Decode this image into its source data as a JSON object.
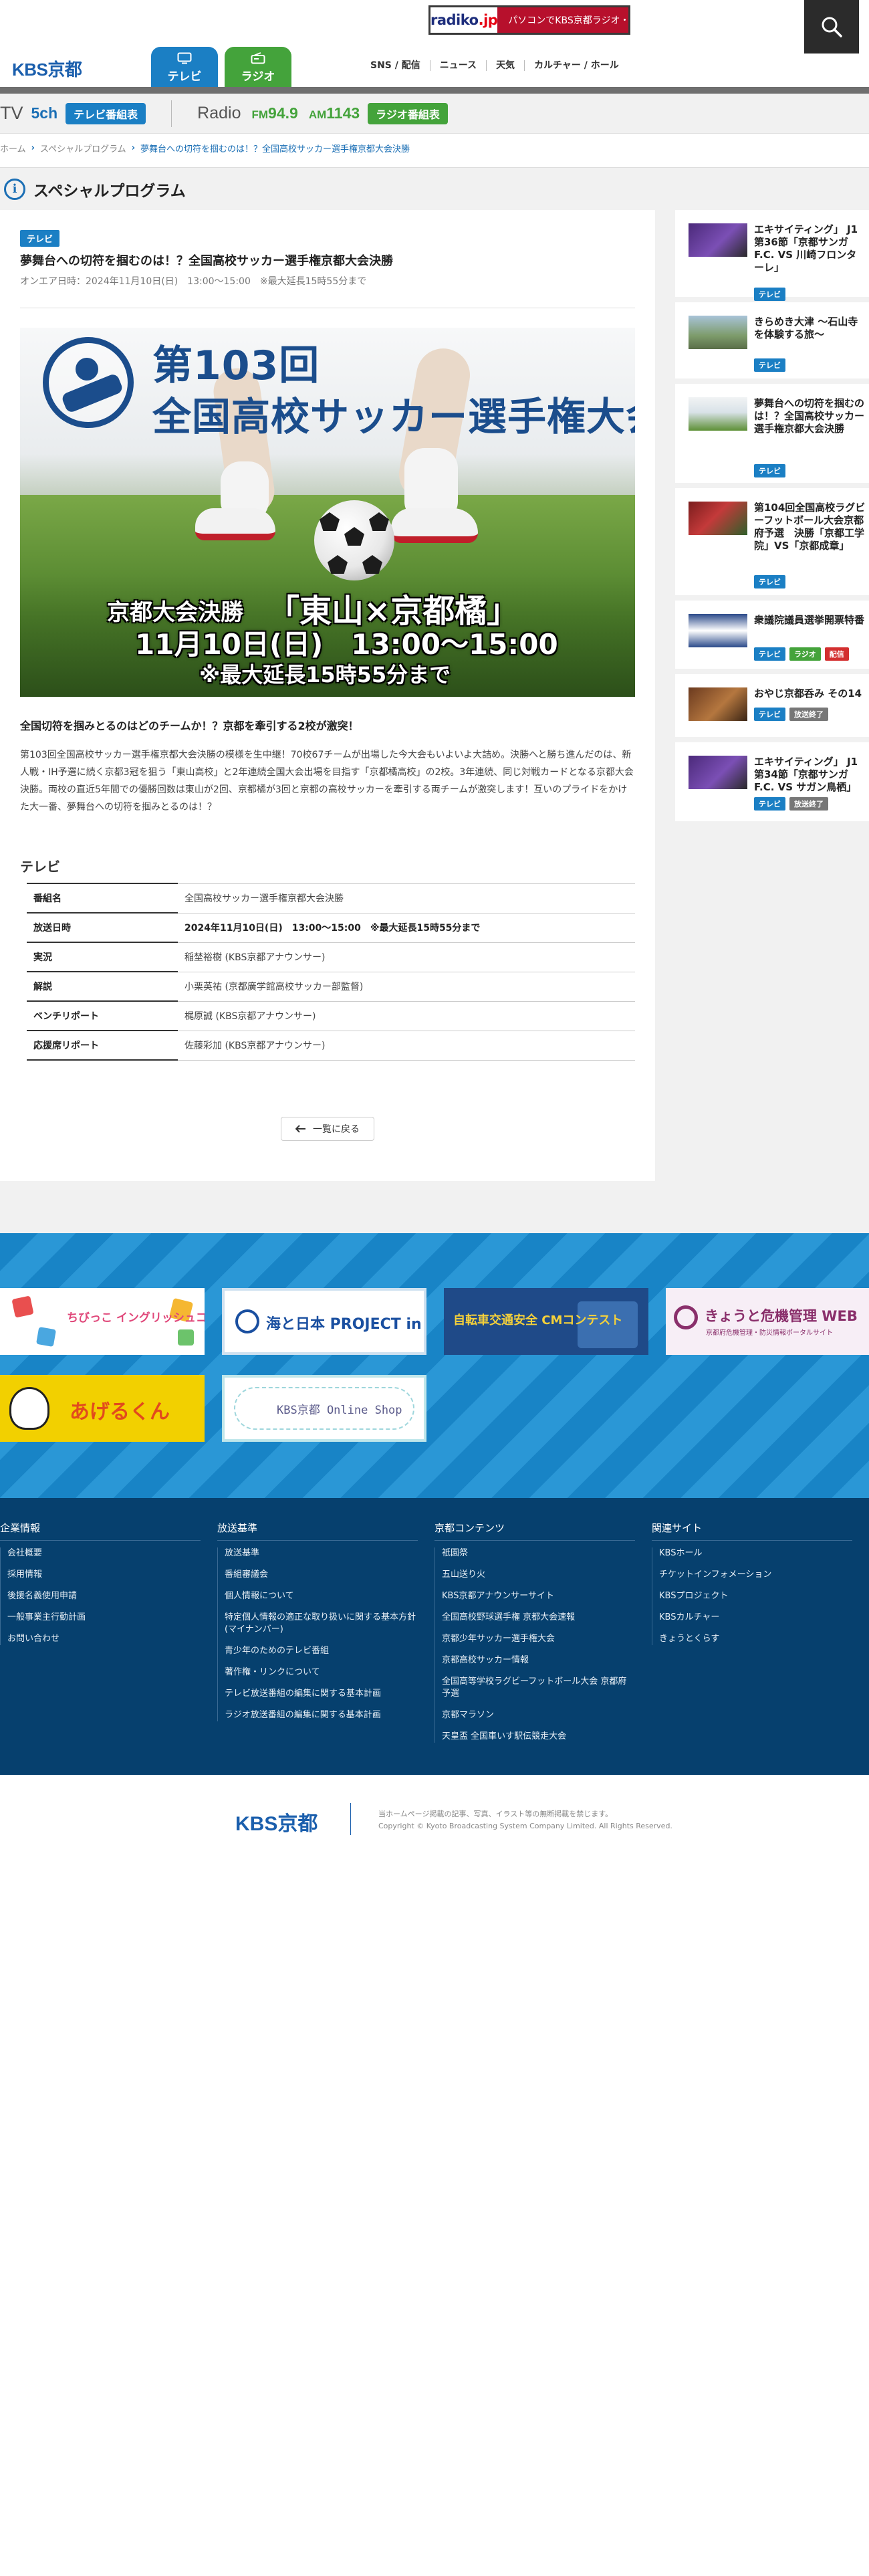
{
  "header": {
    "logo": "KBS京都",
    "radiko": {
      "logo_main": "radiko",
      "logo_dot": ".jp",
      "text": "パソコンでKBS京都ラジオ・・・"
    },
    "tabs": [
      {
        "label": "テレビ"
      },
      {
        "label": "ラジオ"
      }
    ],
    "links": [
      "SNS / 配信",
      "ニュース",
      "天気",
      "カルチャー / ホール"
    ]
  },
  "channels": {
    "tv_label": "TV",
    "tv_num": "5ch",
    "tv_button": "テレビ番組表",
    "radio_label": "Radio",
    "fm_prefix": "FM",
    "fm": "94.9",
    "am_prefix": "AM",
    "am": "1143",
    "radio_button": "ラジオ番組表"
  },
  "breadcrumb": [
    "ホーム",
    "スペシャルプログラム",
    "夢舞台への切符を掴むのは！？全国高校サッカー選手権京都大会決勝"
  ],
  "page": {
    "title": "スペシャルプログラム"
  },
  "program": {
    "tag": "テレビ",
    "title": "夢舞台への切符を掴むのは！？全国高校サッカー選手権京都大会決勝",
    "onair": "オンエア日時：2024年11月10日(日)　13:00〜15:00　※最大延長15時55分まで",
    "hero": {
      "num": "第103回",
      "name": "全国高校サッカー選手権大会",
      "line1a": "京都大会決勝",
      "line1b": "「東山×京都橘」",
      "line2": "11月10日(日)　13:00〜15:00",
      "line3": "※最大延長15時55分まで"
    },
    "lead": "全国切符を掴みとるのはどのチームか！？京都を牽引する2校が激突！",
    "body": "第103回全国高校サッカー選手権京都大会決勝の模様を生中継！70校67チームが出場した今大会もいよいよ大詰め。決勝へと勝ち進んだのは、新人戦・IH予選に続く京都3冠を狙う「東山高校」と2年連続全国大会出場を目指す「京都橘高校」の2校。3年連続、同じ対戦カードとなる京都大会決勝。両校の直近5年間での優勝回数は東山が2回、京都橘が3回と京都の高校サッカーを牽引する両チームが激突します！互いのプライドをかけた大一番、夢舞台への切符を掴みとるのは！？",
    "section": "テレビ",
    "table": [
      {
        "k": "番組名",
        "v": "全国高校サッカー選手権京都大会決勝"
      },
      {
        "k": "放送日時",
        "v": "2024年11月10日(日)　13:00〜15:00　※最大延長15時55分まで"
      },
      {
        "k": "実況",
        "v": "稲埜裕樹 (KBS京都アナウンサー)"
      },
      {
        "k": "解説",
        "v": "小栗英祐 (京都廣学館高校サッカー部監督)"
      },
      {
        "k": "ベンチリポート",
        "v": "梶原誠 (KBS京都アナウンサー)"
      },
      {
        "k": "応援席リポート",
        "v": "佐藤彩加 (KBS京都アナウンサー)"
      }
    ],
    "back": "一覧に戻る"
  },
  "side": [
    {
      "title": "エキサイティング」 J1第36節「京都サンガF.C. VS 川崎フロンターレ」",
      "tags": [
        "テレビ"
      ]
    },
    {
      "title": "きらめき大津 〜石山寺を体験する旅〜",
      "tags": [
        "テレビ"
      ]
    },
    {
      "title": "夢舞台への切符を掴むのは！？全国高校サッカー選手権京都大会決勝",
      "tags": [
        "テレビ"
      ]
    },
    {
      "title": "第104回全国高校ラグビーフットボール大会京都府予選　決勝「京都工学院」VS「京都成章」",
      "tags": [
        "テレビ"
      ]
    },
    {
      "title": "衆議院議員選挙開票特番",
      "tags": [
        "テレビ",
        "ラジオ",
        "配信"
      ]
    },
    {
      "title": "おやじ京都呑み その14",
      "tags": [
        "テレビ",
        "放送終了"
      ]
    },
    {
      "title": "エキサイティング」 J1第34節「京都サンガF.C. VS サガン鳥栖」",
      "tags": [
        "テレビ",
        "放送終了"
      ]
    }
  ],
  "banners": [
    {
      "name": "english-contest",
      "text": "ちびっこ イングリッシュコンテスト"
    },
    {
      "name": "umi-to-nippon",
      "text": "海と日本 PROJECT in 京都"
    },
    {
      "name": "bicycle-safety",
      "text": "自転車交通安全 CMコンテスト"
    },
    {
      "name": "crisis-management",
      "text": "きょうと危機管理 WEB",
      "sub": "京都府危機管理・防災情報ポータルサイト"
    },
    {
      "name": "agerukun",
      "text": "あげるくん"
    },
    {
      "name": "online-shop",
      "text": "KBS京都 Online Shop"
    }
  ],
  "footer": {
    "cols": [
      {
        "title": "企業情報",
        "items": [
          "会社概要",
          "採用情報",
          "後援名義使用申請",
          "一般事業主行動計画",
          "お問い合わせ"
        ]
      },
      {
        "title": "放送基準",
        "items": [
          "放送基準",
          "番組審議会",
          "個人情報について",
          "特定個人情報の適正な取り扱いに関する基本方針(マイナンバー)",
          "青少年のためのテレビ番組",
          "著作権・リンクについて",
          "テレビ放送番組の編集に関する基本計画",
          "ラジオ放送番組の編集に関する基本計画"
        ]
      },
      {
        "title": "京都コンテンツ",
        "items": [
          "祇園祭",
          "五山送り火",
          "KBS京都アナウンサーサイト",
          "全国高校野球選手権 京都大会速報",
          "京都少年サッカー選手権大会",
          "京都高校サッカー情報",
          "全国高等学校ラグビーフットボール大会 京都府予選",
          "京都マラソン",
          "天皇盃 全国車いす駅伝競走大会"
        ]
      },
      {
        "title": "関連サイト",
        "items": [
          "KBSホール",
          "チケットインフォメーション",
          "KBSプロジェクト",
          "KBSカルチャー",
          "きょうとくらす"
        ]
      }
    ],
    "copy_logo": "KBS京都",
    "copy_line1": "当ホームページ掲載の記事、写真、イラスト等の無断掲載を禁じます。",
    "copy_line2": "Copyright © Kyoto Broadcasting System Company Limited. All Rights Reserved."
  }
}
